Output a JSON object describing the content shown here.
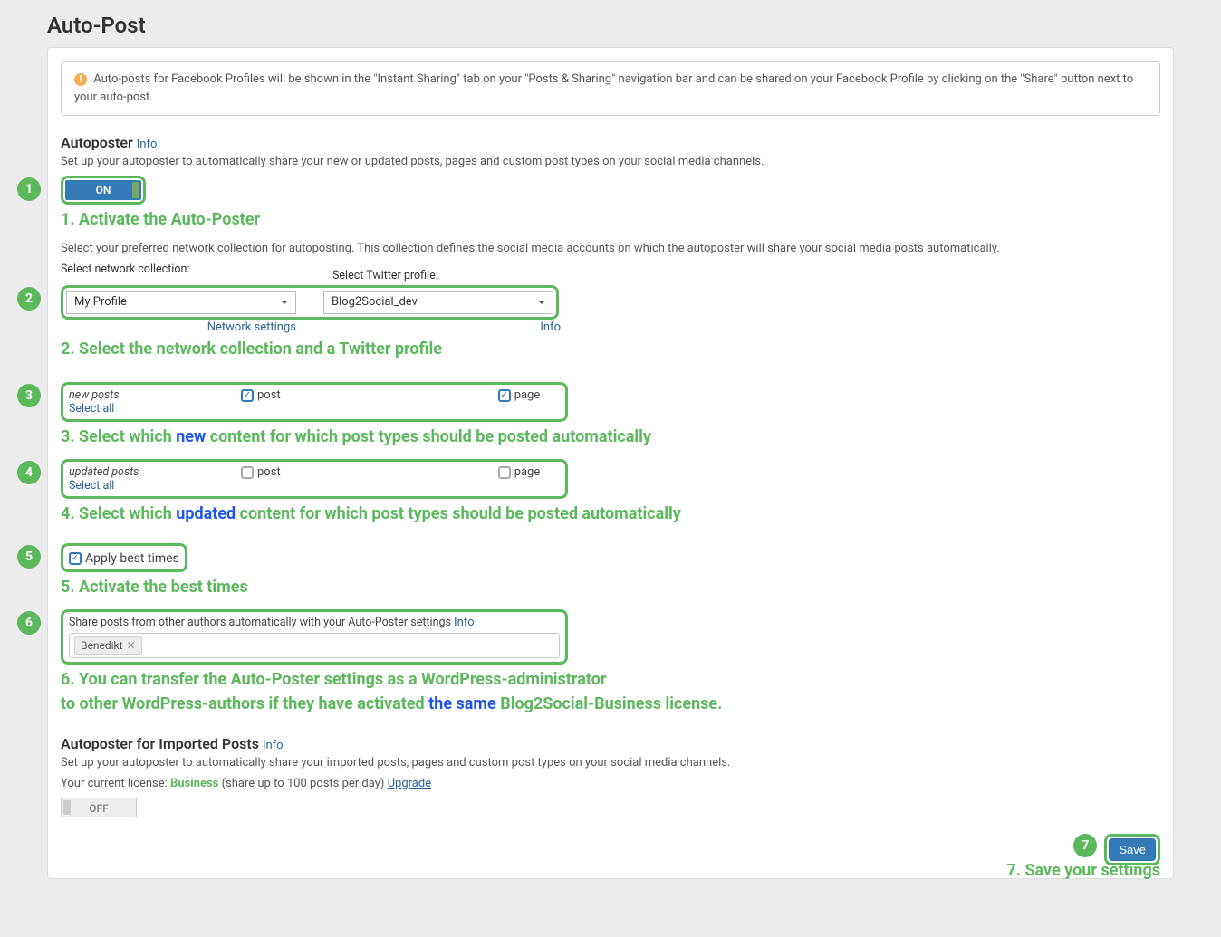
{
  "page_title": "Auto-Post",
  "notice": "Auto-posts for Facebook Profiles will be shown in the \"Instant Sharing\" tab on your \"Posts & Sharing\" navigation bar and can be shared on your Facebook Profile by clicking on the \"Share\" button next to your auto-post.",
  "section1": {
    "heading": "Autoposter",
    "info": "Info",
    "desc": "Set up your autoposter to automatically share your new or updated posts, pages and custom post types on your social media channels.",
    "toggle": "ON"
  },
  "step1": {
    "badge": "1",
    "caption": "1. Activate the Auto-Poster"
  },
  "network_desc": "Select your preferred network collection for autoposting. This collection defines the social media accounts on which the autoposter will share your social media posts automatically.",
  "selects": {
    "left_label": "Select network collection:",
    "left_value": "My Profile",
    "left_sublink": "Network settings",
    "right_label": "Select Twitter profile:",
    "right_value": "Blog2Social_dev",
    "right_sublink": "Info"
  },
  "step2": {
    "badge": "2",
    "caption": "2. Select the network collection and a Twitter profile"
  },
  "step3": {
    "badge": "3",
    "row_label": "new posts",
    "select_all": "Select all",
    "chk_post": "post",
    "chk_page": "page",
    "caption_pre": "3. Select which ",
    "caption_mid": "new",
    "caption_post": " content for which post types should be posted automatically"
  },
  "step4": {
    "badge": "4",
    "row_label": "updated posts",
    "select_all": "Select all",
    "chk_post": "post",
    "chk_page": "page",
    "caption_pre": "4. Select which ",
    "caption_mid": "updated",
    "caption_post": " content for which post types should be posted automatically"
  },
  "step5": {
    "badge": "5",
    "chk_label": "Apply best times",
    "caption": "5. Activate the best times"
  },
  "step6": {
    "badge": "6",
    "share_text": "Share posts from other authors automatically with your Auto-Poster settings",
    "info": "Info",
    "chip": "Benedikt",
    "caption_line1": "6. You can transfer the Auto-Poster settings as a WordPress-administrator",
    "caption_line2_pre": "to other WordPress-authors if they have activated ",
    "caption_line2_mid": "the same",
    "caption_line2_post": " Blog2Social-Business license."
  },
  "section2": {
    "heading": "Autoposter for Imported Posts",
    "info": "Info",
    "desc": "Set up your autoposter to automatically share your imported posts, pages and custom post types on your social media channels.",
    "license_pre": "Your current license: ",
    "license_name": "Business",
    "license_mid": " (share up to 100 posts per day) ",
    "upgrade": "Upgrade",
    "toggle": "OFF"
  },
  "step7": {
    "badge": "7",
    "save": "Save",
    "caption": "7. Save your settings"
  }
}
